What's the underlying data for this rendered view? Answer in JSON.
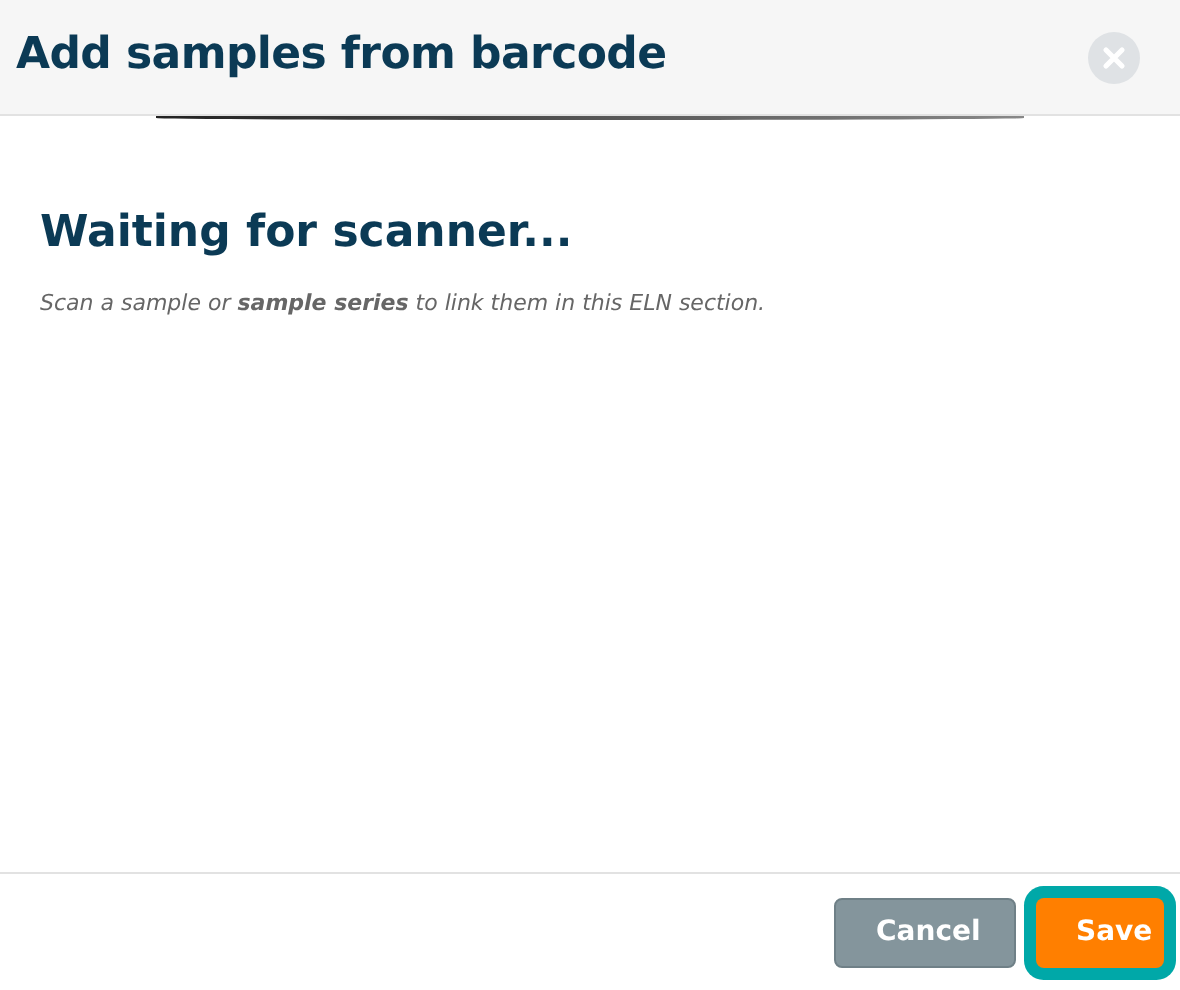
{
  "dialog": {
    "title": "Add samples from barcode"
  },
  "body": {
    "heading": "Waiting for scanner...",
    "hint": "Scan a sample or **sample series** to link them in this ELN section."
  },
  "buttons": [
    {
      "label": "Cancel",
      "kind": "secondary",
      "focused": false
    },
    {
      "label": "Save",
      "kind": "primary",
      "focused": true
    }
  ]
}
